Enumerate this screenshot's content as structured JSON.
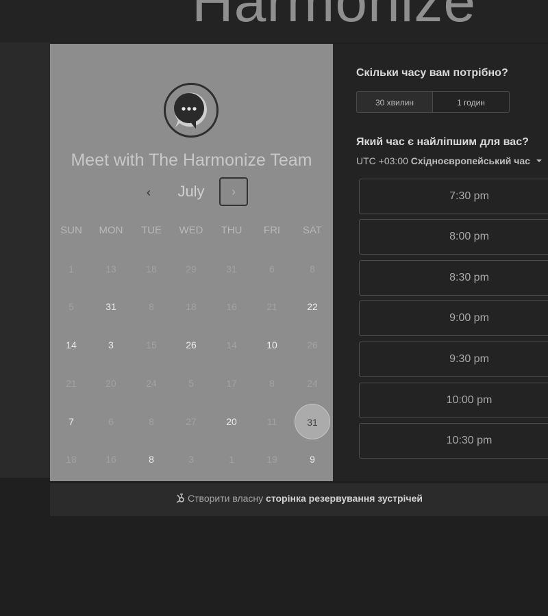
{
  "header": {
    "brand": "Harmonize"
  },
  "calendar": {
    "title": "Meet with The Harmonize Team",
    "month": "July",
    "prev_icon": "‹",
    "next_icon": "›",
    "weekdays": [
      "SUN",
      "MON",
      "TUE",
      "WED",
      "THU",
      "FRI",
      "SAT"
    ],
    "weeks": [
      [
        "1",
        "13",
        "18",
        "29",
        "31",
        "6",
        "8"
      ],
      [
        "5",
        "31",
        "8",
        "18",
        "16",
        "21",
        "22"
      ],
      [
        "14",
        "3",
        "15",
        "26",
        "14",
        "10",
        "26"
      ],
      [
        "21",
        "20",
        "24",
        "5",
        "17",
        "8",
        "24"
      ],
      [
        "7",
        "6",
        "8",
        "27",
        "20",
        "11",
        "31"
      ],
      [
        "18",
        "16",
        "8",
        "3",
        "1",
        "19",
        "9"
      ]
    ],
    "available": [
      [
        1,
        1
      ],
      [
        1,
        6
      ],
      [
        2,
        0
      ],
      [
        2,
        1
      ],
      [
        2,
        3
      ],
      [
        2,
        5
      ],
      [
        4,
        0
      ],
      [
        4,
        4
      ],
      [
        5,
        2
      ],
      [
        5,
        6
      ]
    ],
    "selected": [
      4,
      6
    ]
  },
  "duration": {
    "question": "Скільки часу вам потрібно?",
    "options": [
      "30 хвилин",
      "1 годин"
    ],
    "selected": 0
  },
  "times": {
    "question": "Який час є найліпшим для вас?",
    "timezone_offset": "UTC +03:00",
    "timezone_name": "Східноєвропейський час",
    "slots": [
      "7:30 pm",
      "8:00 pm",
      "8:30 pm",
      "9:00 pm",
      "9:30 pm",
      "10:00 pm",
      "10:30 pm"
    ]
  },
  "footer": {
    "prefix": "Створити власну",
    "link": "сторінка резервування зустрічей"
  },
  "icons": {
    "prev": "chevron-left-icon",
    "next": "chevron-right-icon",
    "avatar": "chat-bubble-icon",
    "timezone_caret": "caret-down-icon",
    "footer": "hubspot-sprocket-icon"
  }
}
